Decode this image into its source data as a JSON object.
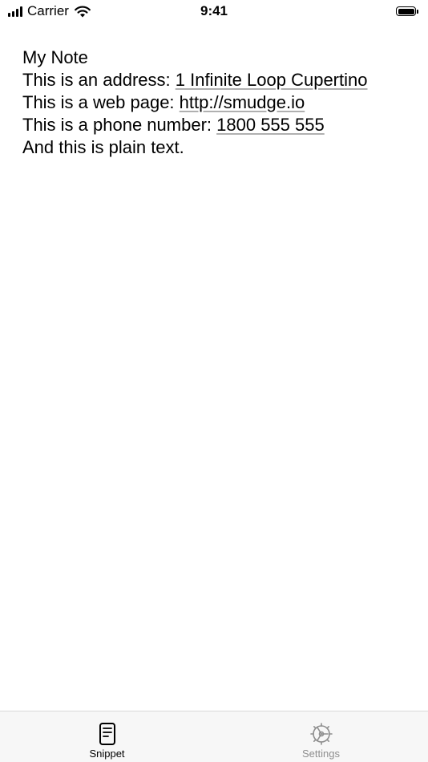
{
  "status_bar": {
    "carrier": "Carrier",
    "time": "9:41",
    "signal_icon": "cellular-signal-icon",
    "wifi_icon": "wifi-icon",
    "battery_icon": "battery-icon"
  },
  "note": {
    "title": "My Note",
    "address_prefix": "This is an address: ",
    "address_link": "1 Infinite Loop Cupertino",
    "web_prefix": "This is a web page: ",
    "web_link": "http://smudge.io",
    "phone_prefix": "This is a phone number: ",
    "phone_link": "1800 555 555",
    "plain_text": "And this is plain text."
  },
  "tab_bar": {
    "tabs": [
      {
        "label": "Snippet",
        "icon": "document-icon",
        "active": true
      },
      {
        "label": "Settings",
        "icon": "gear-icon",
        "active": false
      }
    ]
  },
  "colors": {
    "active_tab": "#000000",
    "inactive_tab": "#8e8e8e",
    "tab_bar_background": "#f7f7f7",
    "link_underline": "#b0b0b0"
  }
}
